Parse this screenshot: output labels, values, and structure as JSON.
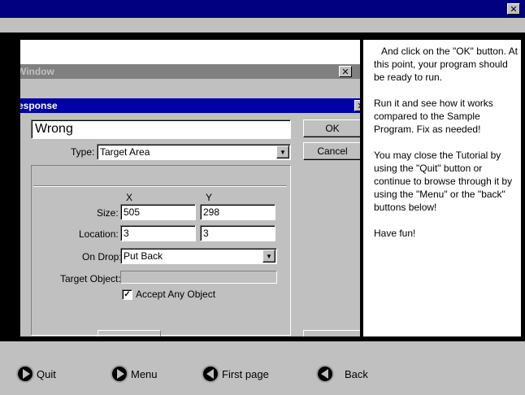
{
  "window": {
    "close_glyph": "✕"
  },
  "screenshot": {
    "bg_window_title": "Window",
    "dialog_title": "esponse",
    "name_value": "Wrong",
    "type_label": "Type:",
    "type_value": "Target Area",
    "ok_label": "OK",
    "cancel_label": "Cancel",
    "col_x": "X",
    "col_y": "Y",
    "size_label": "Size:",
    "size_x": "505",
    "size_y": "298",
    "location_label": "Location:",
    "location_x": "3",
    "location_y": "3",
    "on_drop_label": "On Drop:",
    "on_drop_value": "Put Back",
    "target_object_label": "Target Object:",
    "accept_any_label": "Accept Any Object",
    "accept_any_checked": "✓"
  },
  "tutorial": {
    "para1": "And click on the \"OK\" button. At this point, your program should be ready to run.",
    "para2": "Run it and see how it works compared to the Sample Program.  Fix as needed!",
    "para3": "You may close the Tutorial by using the \"Quit\" button or continue to browse through it by using the \"Menu\" or the \"back\" buttons below!",
    "para4": "Have fun!"
  },
  "nav": {
    "quit": "Quit",
    "menu": "Menu",
    "first_page": "First page",
    "back": "Back"
  }
}
